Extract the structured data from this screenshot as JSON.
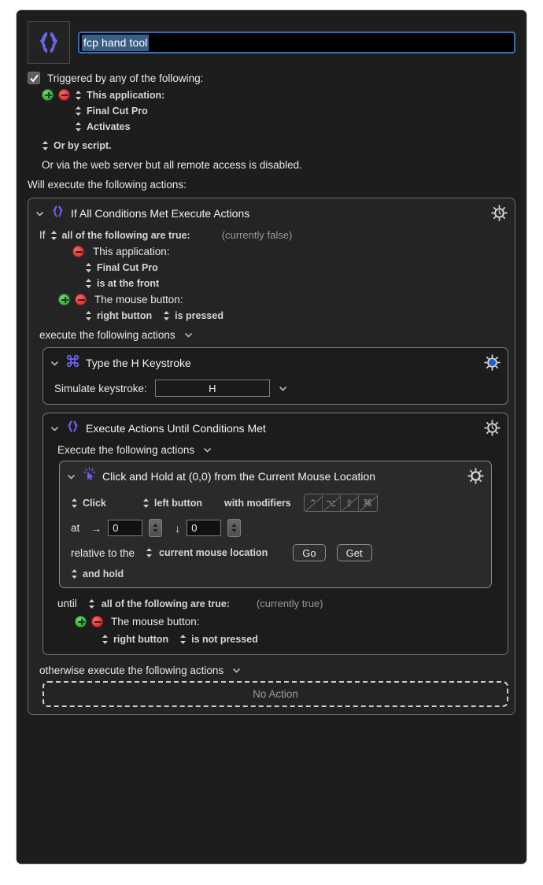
{
  "window": {
    "title": "fcp hand tool"
  },
  "header": {
    "macro_icon": "curly-braces-icon",
    "name_value": "fcp hand tool"
  },
  "trigger": {
    "checkbox_label": "Triggered by any of the following:",
    "checked": true,
    "items": [
      {
        "label": "This application:",
        "add": "+",
        "remove": "-"
      },
      {
        "label": "Final Cut Pro"
      },
      {
        "label": "Activates"
      }
    ],
    "or_by_script": "Or by script.",
    "web_server_note": "Or via the web server but all remote access is disabled."
  },
  "actions_header": "Will execute the following actions:",
  "if_action": {
    "title": "If All Conditions Met Execute Actions",
    "icon": "curly-braces-icon",
    "gear": "gear-clock-icon",
    "if_label": "If",
    "match_mode": "all of the following are true:",
    "status": "(currently false)",
    "conditions": [
      {
        "label": "This application:",
        "lines": [
          "Final Cut Pro",
          "is at the front"
        ]
      },
      {
        "label": "The mouse button:",
        "lines": [
          "right button",
          "is pressed"
        ]
      }
    ],
    "execute_label": "execute the following actions"
  },
  "keystroke_action": {
    "title": "Type the H Keystroke",
    "icon": "command-icon",
    "gear": "gear-blue-icon",
    "field_label": "Simulate keystroke:",
    "keystroke": "H"
  },
  "until_action": {
    "title": "Execute Actions Until Conditions Met",
    "icon": "curly-braces-icon",
    "gear": "gear-clock-icon",
    "execute_label": "Execute the following actions",
    "click_action": {
      "title": "Click and Hold at (0,0) from the Current Mouse Location",
      "icon": "click-cursor-icon",
      "gear": "gear-icon",
      "click_mode": "Click",
      "button": "left button",
      "modifiers_label": "with modifiers",
      "modifiers": [
        {
          "name": "control-key",
          "glyph": "⌃",
          "enabled": false
        },
        {
          "name": "option-key",
          "glyph": "⌥",
          "enabled": false
        },
        {
          "name": "shift-key",
          "glyph": "⇧",
          "enabled": false
        },
        {
          "name": "command-key",
          "glyph": "⌘",
          "enabled": false
        }
      ],
      "at_label": "at",
      "x_value": "0",
      "y_value": "0",
      "relative_label": "relative to the",
      "relative_to": "current mouse location",
      "go_button": "Go",
      "get_button": "Get",
      "hold_label": "and hold"
    },
    "until_label": "until",
    "until_mode": "all of the following are true:",
    "until_status": "(currently true)",
    "until_conditions": [
      {
        "label": "The mouse button:",
        "lines": [
          "right button",
          "is not pressed"
        ]
      }
    ]
  },
  "otherwise": {
    "label": "otherwise execute the following actions",
    "placeholder": "No Action"
  },
  "colors": {
    "accent_purple": "#6c63e8",
    "accent_blue": "#1461d6",
    "window_bg": "#1d1d1d",
    "selection": "#3a5f84"
  }
}
